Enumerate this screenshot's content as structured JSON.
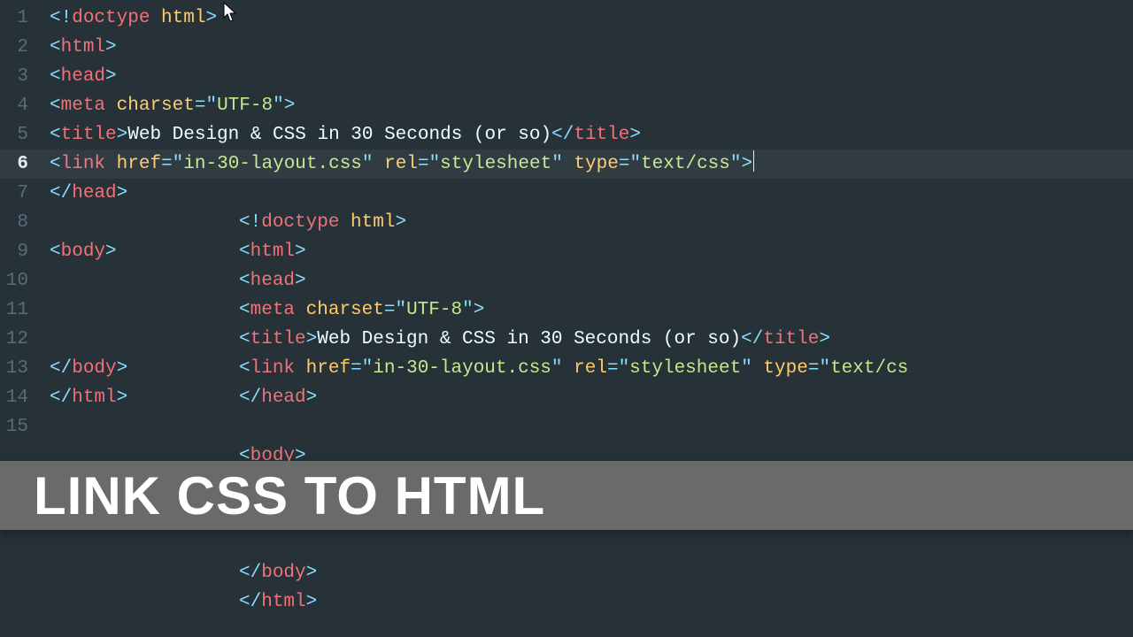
{
  "banner": {
    "title": "LINK CSS TO HTML"
  },
  "gutter": {
    "lines": [
      "1",
      "2",
      "3",
      "4",
      "5",
      "6",
      "7",
      "8",
      "9",
      "10",
      "11",
      "12",
      "13",
      "14",
      "15"
    ],
    "active_index": 5
  },
  "paneA": {
    "l1": {
      "p1": "<!",
      "tag": "doctype",
      "sp": " ",
      "attr": "html",
      "p2": ">"
    },
    "l2": {
      "p1": "<",
      "tag": "html",
      "p2": ">"
    },
    "l3": {
      "p1": "<",
      "tag": "head",
      "p2": ">"
    },
    "l4": {
      "p1": "<",
      "tag": "meta",
      "sp": " ",
      "attr": "charset",
      "eq": "=",
      "q1": "\"",
      "val": "UTF-8",
      "q2": "\"",
      "p2": ">"
    },
    "l5": {
      "p1": "<",
      "tag": "title",
      "p2": ">",
      "text": "Web Design & CSS in 30 Seconds (or so)",
      "p3": "</",
      "tag2": "title",
      "p4": ">"
    },
    "l6": {
      "p1": "<",
      "tag": "link",
      "sp": " ",
      "a1": "href",
      "e1": "=",
      "q1a": "\"",
      "v1": "in-30-layout.css",
      "q1b": "\" ",
      "a2": "rel",
      "e2": "=",
      "q2a": "\"",
      "v2": "stylesheet",
      "q2b": "\" ",
      "a3": "type",
      "e3": "=",
      "q3a": "\"",
      "v3": "text/css",
      "q3b": "\"",
      "p2": ">"
    },
    "l7": {
      "p1": "</",
      "tag": "head",
      "p2": ">"
    },
    "l9": {
      "p1": "<",
      "tag": "body",
      "p2": ">"
    },
    "l13": {
      "p1": "</",
      "tag": "body",
      "p2": ">"
    },
    "l14": {
      "p1": "</",
      "tag": "html",
      "p2": ">"
    }
  },
  "paneB": {
    "l8": {
      "p1": "<!",
      "tag": "doctype",
      "sp": " ",
      "attr": "html",
      "p2": ">"
    },
    "l9": {
      "p1": "<",
      "tag": "html",
      "p2": ">"
    },
    "l10": {
      "p1": "<",
      "tag": "head",
      "p2": ">"
    },
    "l11": {
      "p1": "<",
      "tag": "meta",
      "sp": " ",
      "attr": "charset",
      "eq": "=",
      "q1": "\"",
      "val": "UTF-8",
      "q2": "\"",
      "p2": ">"
    },
    "l12": {
      "p1": "<",
      "tag": "title",
      "p2": ">",
      "text": "Web Design & CSS in 30 Seconds (or so)",
      "p3": "</",
      "tag2": "title",
      "p4": ">"
    },
    "l13": {
      "p1": "<",
      "tag": "link",
      "sp": " ",
      "a1": "href",
      "e1": "=",
      "q1a": "\"",
      "v1": "in-30-layout.css",
      "q1b": "\" ",
      "a2": "rel",
      "e2": "=",
      "q2a": "\"",
      "v2": "stylesheet",
      "q2b": "\" ",
      "a3": "type",
      "e3": "=",
      "q3a": "\"",
      "v3": "text/cs",
      "q3b": "",
      "p2": ""
    },
    "l14": {
      "p1": "</",
      "tag": "head",
      "p2": ">"
    },
    "body_open": {
      "p1": "<",
      "tag": "body",
      "p2": ">"
    },
    "body_close": {
      "p1": "</",
      "tag": "body",
      "p2": ">"
    },
    "html_close": {
      "p1": "</",
      "tag": "html",
      "p2": ">"
    }
  }
}
